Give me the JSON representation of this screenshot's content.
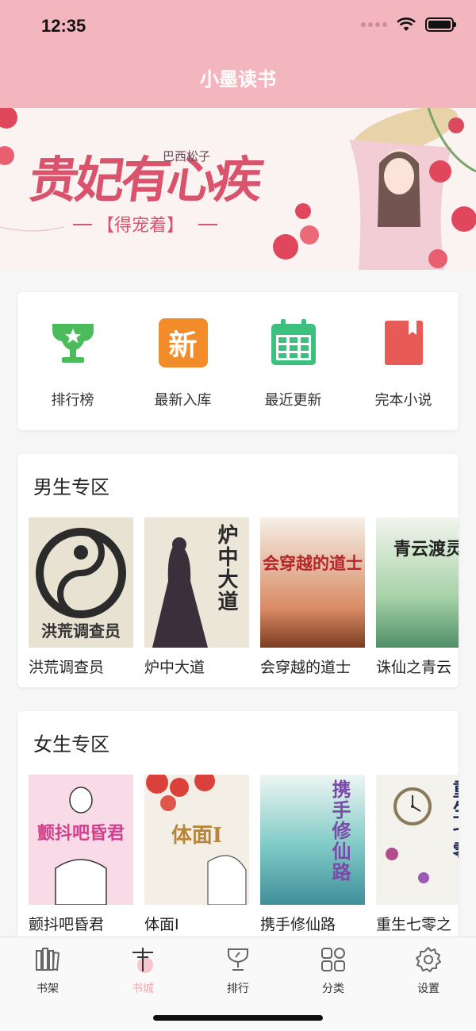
{
  "status_bar": {
    "time": "12:35"
  },
  "app": {
    "title": "小墨读书"
  },
  "banner": {
    "title": "贵妃有心疾",
    "author": "巴西松子",
    "subtitle": "【得宠着】"
  },
  "quick_links": [
    {
      "label": "排行榜",
      "icon": "trophy-icon",
      "color": "#4cbb5b"
    },
    {
      "label": "最新入库",
      "icon": "new-badge-icon",
      "icon_text": "新",
      "color": "#f28c2a"
    },
    {
      "label": "最近更新",
      "icon": "calendar-icon",
      "color": "#3cc07e"
    },
    {
      "label": "完本小说",
      "icon": "bookmark-book-icon",
      "color": "#e85a55"
    }
  ],
  "male_section": {
    "title": "男生专区",
    "books": [
      {
        "name": "洪荒调查员",
        "cover_text": "洪荒调查员"
      },
      {
        "name": "炉中大道",
        "cover_text": "炉中大道"
      },
      {
        "name": "会穿越的道士",
        "cover_text": "会穿越的道士"
      },
      {
        "name": "诛仙之青云",
        "cover_text": "青云渡灵"
      }
    ]
  },
  "female_section": {
    "title": "女生专区",
    "books": [
      {
        "name": "颤抖吧昏君",
        "cover_text": "颤抖吧昏君"
      },
      {
        "name": "体面I",
        "cover_text": "体面I"
      },
      {
        "name": "携手修仙路",
        "cover_text": "携手修仙路"
      },
      {
        "name": "重生七零之",
        "cover_text": "重生七零"
      }
    ]
  },
  "tabbar": [
    {
      "label": "书架",
      "icon": "bookshelf-icon",
      "active": false
    },
    {
      "label": "书城",
      "icon": "book-store-icon",
      "active": true
    },
    {
      "label": "排行",
      "icon": "trophy-icon",
      "active": false
    },
    {
      "label": "分类",
      "icon": "category-grid-icon",
      "active": false
    },
    {
      "label": "设置",
      "icon": "gear-icon",
      "active": false
    }
  ],
  "colors": {
    "header": "#f4b6be",
    "active_tab": "#f0a7b0"
  }
}
